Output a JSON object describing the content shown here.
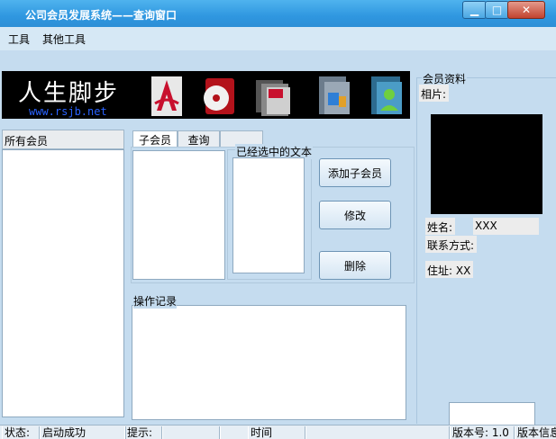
{
  "window": {
    "title": "公司会员发展系统——查询窗口"
  },
  "menu": {
    "tools": "工具",
    "other_tools": "其他工具"
  },
  "banner": {
    "title": "人生脚步",
    "url": "www.rsjb.net"
  },
  "members": {
    "header": "所有会员"
  },
  "tabs": [
    {
      "label": "子会员"
    },
    {
      "label": "查询"
    },
    {
      "label": ""
    }
  ],
  "selected_group": {
    "label": "已经选中的文本"
  },
  "buttons": {
    "add_child": "添加子会员",
    "edit": "修改",
    "delete": "删除"
  },
  "log": {
    "label": "操作记录"
  },
  "member_info": {
    "label": "会员资料",
    "photo_label": "相片:",
    "name_label": "姓名:",
    "name_value": "XXX",
    "contact_label": "联系方式:",
    "address_label": "住址: XX"
  },
  "statusbar": {
    "status_label": "状态:",
    "status_value": "启动成功",
    "tip_label": "提示:",
    "time_label": "时间",
    "version_label": "版本号: 1.0",
    "version_label2": "版本信息"
  },
  "colors": {
    "accent": "#2f97e0",
    "panel_bg": "#c5dcef"
  }
}
